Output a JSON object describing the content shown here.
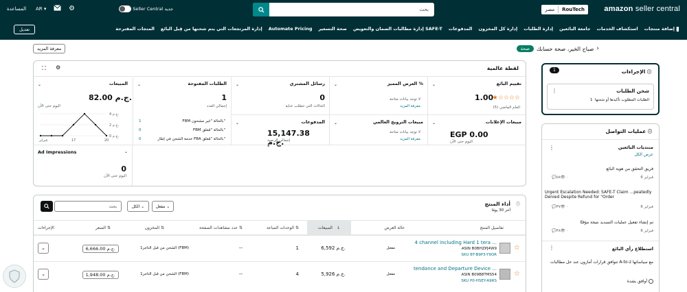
{
  "topbar": {
    "brand_a": "amazon",
    "brand_b": " seller central",
    "store_name": "RouTech",
    "store_region": "مصر",
    "search_placeholder": "بحث",
    "seller_central_label": "Seller Central جديد",
    "lang": "AR",
    "help": "المساعدة"
  },
  "nav": {
    "items": [
      "إضافة منتجات",
      "استكشاف الخدمات",
      "جامعة البائعين",
      "إدارة الطلبات",
      "إدارة كل المخزون",
      "المدفوعات",
      "إدارة مطالبات الضمان والتعويض SAFE-T",
      "صحة التسعير",
      "Automate Pricing",
      "إدارة المرتجعات التي يتم شحنها من قِبل البائع",
      "المتجات المقترحة"
    ],
    "edit": "تعديل"
  },
  "greeting": {
    "text": "صباح الخير، صحة حسابك",
    "badge": "صحة",
    "learn_more": "معرفة المزيد"
  },
  "snapshot": {
    "title": "لقطة عالمية",
    "sales": {
      "title": "المبيعات",
      "value": "82.00 ج.م.",
      "sub": "اليوم حتى الآن",
      "y_ticks": [
        "4 ج.م.",
        "2 ج.م.",
        "0 ج.م."
      ],
      "x_ticks": [
        "14 فبراير",
        "17",
        "20"
      ]
    },
    "open_orders": {
      "title": "الطلبات المفتوحة",
      "value": "1",
      "sub": "إجمالي العدد",
      "rows": [
        {
          "label": "FBM بالحالة \"غير مشحون\"",
          "value": "1"
        },
        {
          "label": "FBM بالحالة \"مُعلق\"",
          "value": "0"
        },
        {
          "label": "خدمة الشحن في إطار FBA بالحالة \"مُعلق\"",
          "value": "0"
        }
      ]
    },
    "buyer_messages": {
      "title": "رسائل المشتري",
      "value": "0",
      "sub": "الحالات التي تتطلب عناية"
    },
    "featured_offer": {
      "title": "العرض المميز %",
      "sub": "لا توجد بيانات متاحة",
      "link": "معرفة المزيد"
    },
    "seller_feedback": {
      "title": "تقييم البائع",
      "value": "1.00",
      "sub": "العام الماضي (5)"
    },
    "payments": {
      "title": "المدفوعات",
      "value": "15,147.38 ج.م.",
      "sub": "إجمالي الرصيد"
    },
    "global_promo": {
      "title": "مبيعات الترويج العالمي",
      "sub": "لا توجد بيانات متاحة",
      "link": "معرفة المزيد"
    },
    "ad_sales": {
      "title": "مبيعات الإعلانات",
      "value": "EGP 0.00",
      "sub": "اليوم حتى الآن"
    },
    "ad_impressions": {
      "title": "Ad Impressions",
      "value": "0",
      "sub": "اليوم حتى الآن"
    }
  },
  "chart_data": {
    "type": "line",
    "x": [
      14,
      15,
      16,
      17,
      18,
      19,
      20
    ],
    "values": [
      0,
      0,
      0,
      2,
      4,
      2,
      0
    ],
    "x_ticks": [
      "14 فبراير",
      "17",
      "20"
    ],
    "y_ticks": [
      "4 ج.م.",
      "2 ج.م.",
      "0 ج.م."
    ],
    "ylim": [
      0,
      4
    ]
  },
  "actions": {
    "title": "الإجراءات",
    "count": "1",
    "item_title": "شحن الطلبات",
    "item_sub": "الطلبات المطلوب تأكيدها أو شحنها",
    "item_count": "1"
  },
  "comm": {
    "title": "عمليات التواصل",
    "forums_title": "منتديات البائعين",
    "view_all": "عرض الكل",
    "posts": [
      {
        "title": "فريق التحقق من هوية البائع",
        "date": "فبراير 6",
        "views": "٥٨",
        "replies": "٠"
      },
      {
        "title": "Urgent Escalation Needed: SAFE-T Claim ...peatedly Denied Despite Refund for \"Order",
        "date": "فبراير 6",
        "views": "٣٧",
        "replies": "٠"
      },
      {
        "title": "تم إنشاء تفعيل عمليات التسديد نتيجة مؤقتًا",
        "date": "فبراير 6",
        "views": "٣٨",
        "replies": "٠"
      }
    ],
    "survey_title": "استطلاع رأي البائع",
    "survey_q": "تتوافق قرارات أمازون عند حل مطالبات A-to-z مع سياساتها",
    "survey_opt": "أوافق بشدة"
  },
  "performance": {
    "title": "أداء المنتج",
    "sub": "آخر 30 يومًا",
    "search_placeholder": "بحث",
    "filter_all": "الكل",
    "filter_active": "مفعل",
    "columns": [
      "تفاصيل المنتج",
      "حالة العرض",
      "المبيعات",
      "الوحدات المباعة",
      "عدد مشاهدات الصفحة",
      "المخزون",
      "السعر",
      "الإجراءات"
    ],
    "rows": [
      {
        "title": "4 channel including Hard 1 tera ...",
        "asin": "ASIN B0BHZPJ4W9",
        "sku": "SKU BT-B9P3-Y9OR",
        "status": "مفعل",
        "sales": "6,592 ج.م.",
        "units": "1",
        "views": "--",
        "inventory": "1الشحن من قبل التاجر (FBM)",
        "price": "6,666.00 ج.م."
      },
      {
        "title": "tendance and Departure Device ...",
        "asin": "ASIN B09B8TMS54",
        "sku": "SKU P0-HSEY-A9RS",
        "status": "مفعل",
        "sales": "5,926 ج.م.",
        "units": "4",
        "views": "--",
        "inventory": "1الشحن من قبل التاجر (FBM)",
        "price": "1,948.00 ج.م."
      }
    ]
  }
}
